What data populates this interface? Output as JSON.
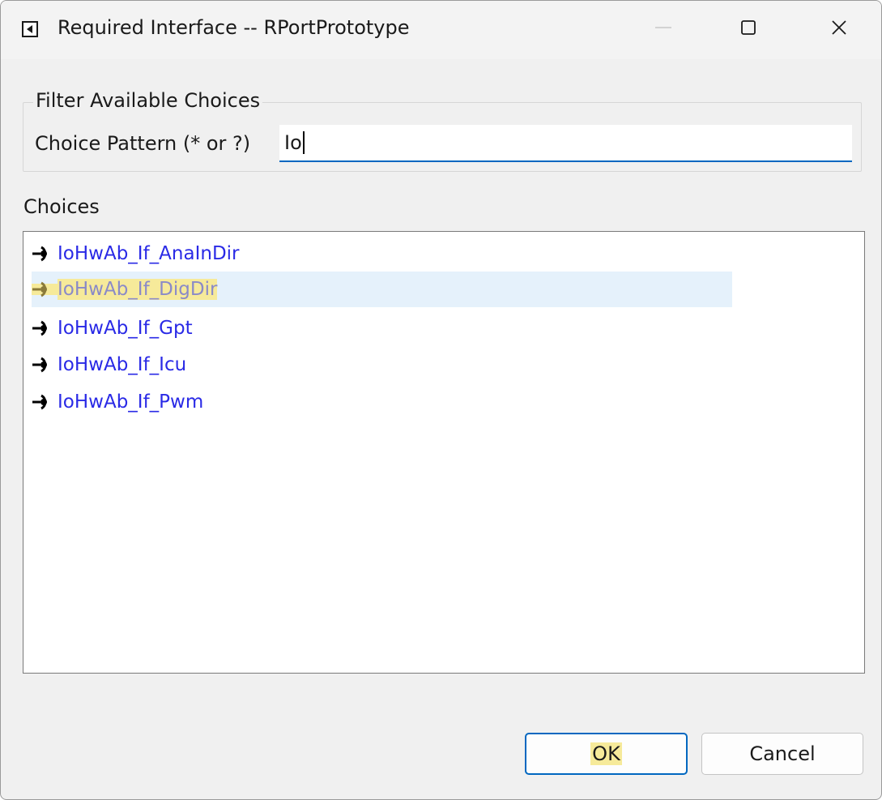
{
  "window": {
    "title": "Required Interface -- RPortPrototype"
  },
  "filter": {
    "legend": "Filter Available Choices",
    "pattern_label": "Choice Pattern (* or ?)",
    "pattern_value": "Io"
  },
  "choices": {
    "label": "Choices",
    "items": [
      {
        "label": "IoHwAb_If_AnaInDir",
        "selected": false,
        "icon": "required-interface-icon"
      },
      {
        "label": "IoHwAb_If_DigDir",
        "selected": true,
        "icon": "required-interface-icon"
      },
      {
        "label": "IoHwAb_If_Gpt",
        "selected": false,
        "icon": "required-interface-icon"
      },
      {
        "label": "IoHwAb_If_Icu",
        "selected": false,
        "icon": "required-interface-icon"
      },
      {
        "label": "IoHwAb_If_Pwm",
        "selected": false,
        "icon": "required-interface-icon"
      }
    ]
  },
  "buttons": {
    "ok": "OK",
    "cancel": "Cancel"
  },
  "colors": {
    "accent": "#0067c0",
    "item_text": "#2a2ae6",
    "selection_bg": "#e5f1fb",
    "highlight": "#f6ea9a"
  }
}
